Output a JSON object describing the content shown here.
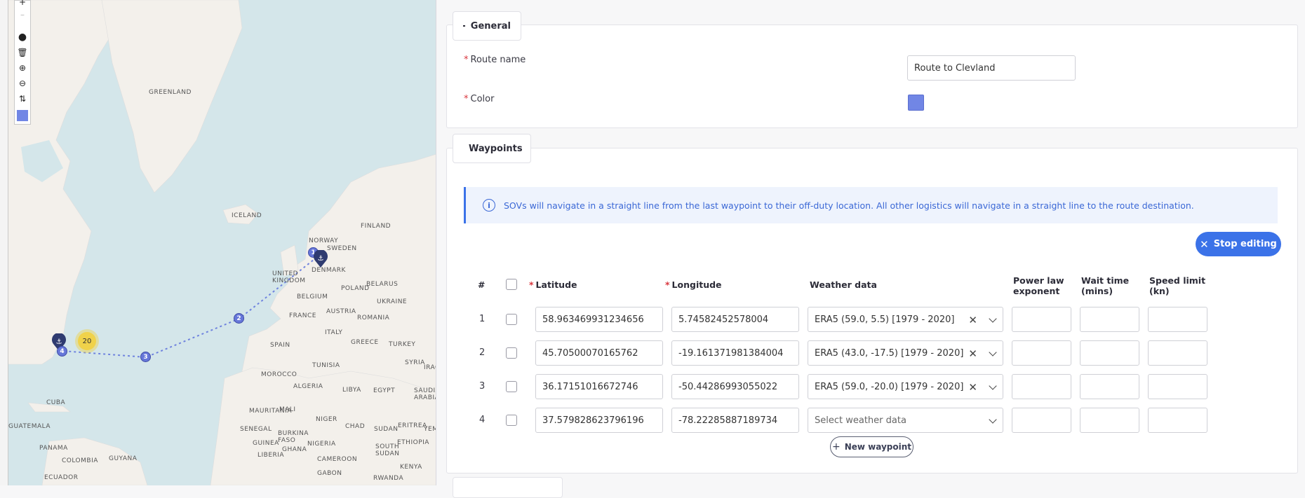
{
  "map": {
    "labels": {
      "greenland": "GREENLAND",
      "iceland": "ICELAND",
      "norway": "NORWAY",
      "sweden": "SWEDEN",
      "finland": "FINLAND",
      "denmark": "DENMARK",
      "united_kingdom": "UNITED KINGDOM",
      "belarus": "BELARUS",
      "poland": "POLAND",
      "belgium": "BELGIUM",
      "ukraine": "UKRAINE",
      "france": "FRANCE",
      "austria": "AUSTRIA",
      "romania": "ROMANIA",
      "italy": "ITALY",
      "spain": "SPAIN",
      "greece": "GREECE",
      "turkey": "TURKEY",
      "tunisia": "TUNISIA",
      "syria": "SYRIA",
      "iraq": "IRAQ",
      "morocco": "MOROCCO",
      "algeria": "ALGERIA",
      "libya": "LIBYA",
      "egypt": "EGYPT",
      "saudi_arabia": "SAUDI ARABIA",
      "cuba": "CUBA",
      "mauritania": "MAURITANIA",
      "mali": "MALI",
      "niger": "NIGER",
      "chad": "CHAD",
      "sudan": "SUDAN",
      "eritrea": "ERITREA",
      "yemen": "YEMEN",
      "guatemala": "GUATEMALA",
      "senegal": "SENEGAL",
      "burkina_faso": "BURKINA FASO",
      "guinea": "GUINEA",
      "nigeria": "NIGERIA",
      "south_sudan": "SOUTH SUDAN",
      "ethiopia": "ETHIOPIA",
      "panama": "PANAMA",
      "guyana": "GUYANA",
      "colombia": "COLOMBIA",
      "liberia": "LIBERIA",
      "ghana": "GHANA",
      "cameroon": "CAMEROON",
      "ecuador": "ECUADOR",
      "gabon": "GABON",
      "rwanda": "RWANDA",
      "kenya": "KENYA"
    },
    "cluster_count": "20",
    "waypoint_badges": [
      "1",
      "2",
      "3",
      "4"
    ],
    "route_color": "#7186e5"
  },
  "general": {
    "legend": "General",
    "route_name_label": "Route name",
    "route_name_value": "Route to Clevland",
    "color_label": "Color",
    "color_value": "#7186e5"
  },
  "waypoints": {
    "legend": "Waypoints",
    "info_text": "SOVs will navigate in a straight line from the last waypoint to their off-duty location. All other logistics will navigate in a straight line to the route destination.",
    "stop_editing_label": "Stop editing",
    "new_waypoint_label": "New waypoint",
    "headers": {
      "index": "#",
      "latitude": "Latitude",
      "longitude": "Longitude",
      "weather": "Weather data",
      "power_law_1": "Power law",
      "power_law_2": "exponent",
      "wait_time_1": "Wait time",
      "wait_time_2": "(mins)",
      "speed_limit_1": "Speed limit",
      "speed_limit_2": "(kn)"
    },
    "rows": [
      {
        "index": "1",
        "lat": "58.963469931234656",
        "lon": "5.74582452578004",
        "weather": "ERA5 (59.0, 5.5) [1979 - 2020]"
      },
      {
        "index": "2",
        "lat": "45.70500070165762",
        "lon": "-19.161371981384004",
        "weather": "ERA5 (43.0, -17.5) [1979 - 2020]"
      },
      {
        "index": "3",
        "lat": "36.17151016672746",
        "lon": "-50.44286993055022",
        "weather": "ERA5 (59.0, -20.0) [1979 - 2020]"
      },
      {
        "index": "4",
        "lat": "37.579828623796196",
        "lon": "-78.22285887189734",
        "weather": ""
      }
    ],
    "weather_placeholder": "Select weather data"
  }
}
